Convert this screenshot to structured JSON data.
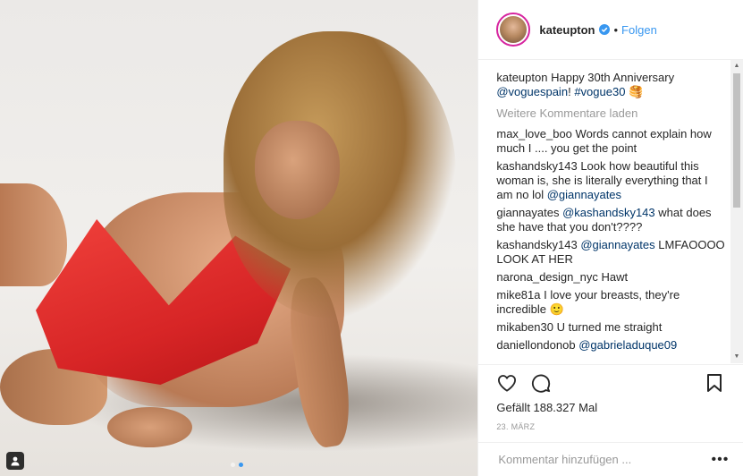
{
  "header": {
    "username": "kateupton",
    "separator": "•",
    "follow_label": "Folgen"
  },
  "caption": {
    "username": "kateupton",
    "text": "Happy 30th Anniversary",
    "mention": "@voguespain",
    "after_mention": "!",
    "hashtag": "#vogue30",
    "emoji": "🥞"
  },
  "load_more": "Weitere Kommentare laden",
  "comments": [
    {
      "user": "max_love_boo",
      "text": "Words cannot explain how much I .... you get the point"
    },
    {
      "user": "kashandsky143",
      "text": "Look how beautiful this woman is, she is literally everything that I am no lol",
      "mention": "@giannayates"
    },
    {
      "user": "giannayates",
      "mention_first": "@kashandsky143",
      "text": "what does she have that you don't????"
    },
    {
      "user": "kashandsky143",
      "mention_first": "@giannayates",
      "text": "LMFAOOOO LOOK AT HER"
    },
    {
      "user": "narona_design_nyc",
      "text": "Hawt"
    },
    {
      "user": "mike81a",
      "text": "I love your breasts, they're incredible",
      "emoji": "🙂"
    },
    {
      "user": "mikaben30",
      "text": "U turned me straight"
    },
    {
      "user": "daniellondonob",
      "mention_first": "@gabrieladuque09",
      "text": ""
    }
  ],
  "likes": "Gefällt 188.327 Mal",
  "date": "23. MÄRZ",
  "add_comment_placeholder": "Kommentar hinzufügen ...",
  "more_label": "•••",
  "icons": {
    "like": "heart-icon",
    "comment": "comment-icon",
    "save": "bookmark-icon",
    "tag": "person-tag-icon",
    "verified": "verified-badge-icon"
  },
  "colors": {
    "link": "#3897f0",
    "mention": "#003569",
    "muted": "#999999",
    "text": "#262626"
  },
  "carousel": {
    "count": 2,
    "active_index": 1
  }
}
